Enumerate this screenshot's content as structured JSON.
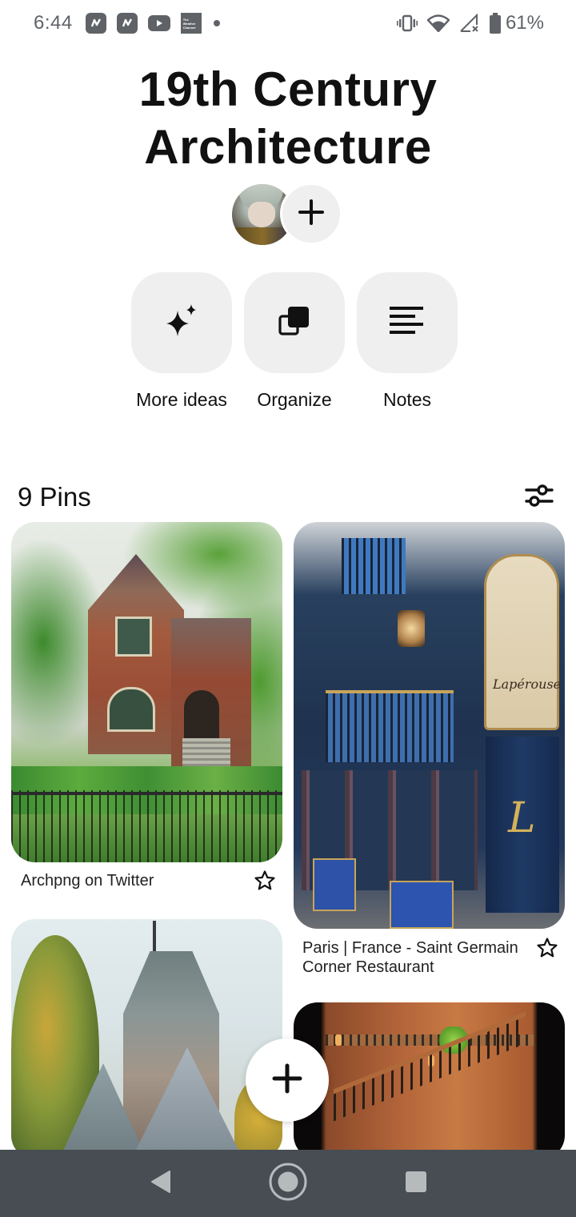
{
  "status_bar": {
    "time": "6:44",
    "notification_icons": [
      "news-app-icon",
      "news-app-icon",
      "youtube-icon",
      "weather-channel-icon",
      "more-notifications-dot"
    ],
    "weather_icon_text": "The Weather Channel",
    "system_icons": [
      "vibrate-icon",
      "wifi-icon",
      "no-signal-icon",
      "battery-icon"
    ],
    "battery_percent": "61%"
  },
  "board": {
    "title": "19th Century Architecture",
    "collaborators": {
      "avatar_label": "Board owner avatar",
      "add_collaborator_icon": "plus-icon"
    }
  },
  "actions": [
    {
      "label": "More ideas",
      "icon": "sparkle-icon"
    },
    {
      "label": "Organize",
      "icon": "organize-icon"
    },
    {
      "label": "Notes",
      "icon": "notes-icon"
    }
  ],
  "pins_section": {
    "count_label": "9 Pins",
    "filter_icon": "filter-sliders-icon"
  },
  "pins": [
    {
      "title": "Archpng on Twitter",
      "image": "Victorian brick house with gated garden",
      "favorite_icon": "star-outline-icon"
    },
    {
      "title": "Paris | France - Saint Germain Corner Restaurant",
      "image": "Blue Parisian restaurant facade with Lapérouse sign",
      "sign_text": "Lapérouse",
      "favorite_icon": "star-outline-icon"
    },
    {
      "title": "",
      "image": "Gothic stone mansion with slate roofs and autumn trees"
    },
    {
      "title": "",
      "image": "Ornate iron staircase in warm-lit interior"
    }
  ],
  "fab": {
    "icon": "plus-icon"
  },
  "nav_bar": {
    "back_icon": "back-triangle-icon",
    "home_icon": "home-circle-icon",
    "recents_icon": "recents-square-icon"
  }
}
